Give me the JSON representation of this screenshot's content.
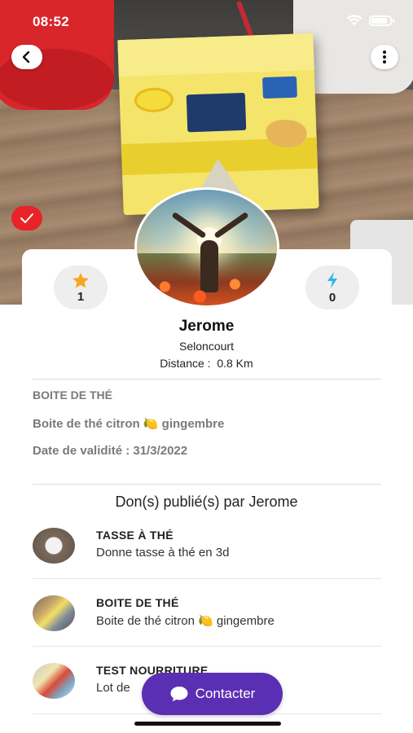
{
  "status_bar": {
    "time": "08:52",
    "wifi_icon": "wifi-icon",
    "battery_icon": "battery-icon",
    "battery_level": 0.85
  },
  "header": {
    "back_icon": "chevron-left-icon",
    "more_icon": "more-vertical-icon",
    "verified_icon": "check-icon"
  },
  "profile": {
    "name": "Jerome",
    "city": "Seloncourt",
    "distance": "Distance :  0.8 Km",
    "stars": {
      "icon": "star-icon",
      "value": "1"
    },
    "bolts": {
      "icon": "lightning-icon",
      "value": "0"
    }
  },
  "item": {
    "category": "BOITE DE THÉ",
    "description": "Boite de thé citron 🍋 gingembre",
    "validity": "Date de validité : 31/3/2022"
  },
  "donations": {
    "title": "Don(s) publié(s) par Jerome",
    "items": [
      {
        "title": "TASSE À THÉ",
        "description": "Donne tasse à thé en 3d"
      },
      {
        "title": "BOITE DE THÉ",
        "description": "Boite de thé citron 🍋 gingembre"
      },
      {
        "title": "TEST NOURRITURE",
        "description": "Lot de"
      }
    ]
  },
  "contact_button": {
    "label": "Contacter",
    "icon": "chat-bubble-icon"
  },
  "colors": {
    "accent": "#5b2fb3",
    "star": "#f5a623",
    "bolt": "#2ab7e8",
    "badge": "#e8232a"
  }
}
